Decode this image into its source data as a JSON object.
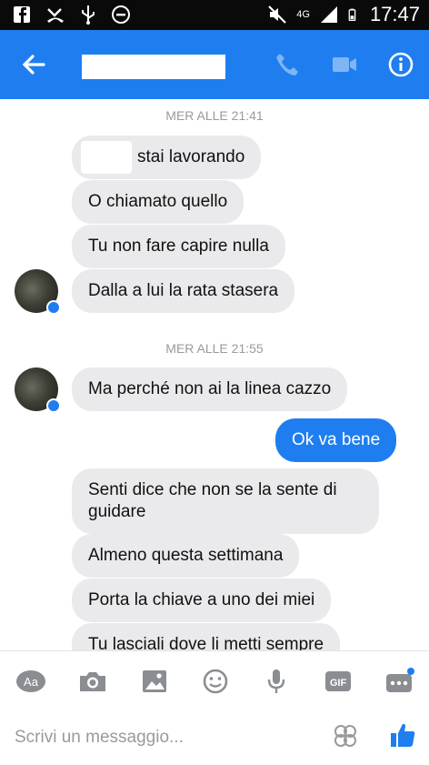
{
  "status_bar": {
    "time": "17:47",
    "network": "4G"
  },
  "header": {
    "contact_name": ""
  },
  "chat": {
    "separators": [
      "MER ALLE 21:41",
      "MER ALLE 21:55"
    ],
    "messages": [
      "stai lavorando",
      "O chiamato quello",
      "Tu non fare capire nulla",
      "Dalla a lui la rata stasera",
      "Ma perché non ai la linea cazzo",
      "Ok va bene",
      "Senti dice che non se la sente di guidare",
      "Almeno questa settimana",
      "Porta la chiave a uno dei miei",
      "Tu lasciali dove li metti sempre"
    ]
  },
  "composer": {
    "placeholder": "Scrivi un messaggio..."
  },
  "colors": {
    "accent": "#1e7ef0",
    "incoming_bubble": "#eaeaec",
    "status_bar": "#0a0a0a"
  },
  "icons": [
    "back-arrow-icon",
    "phone-icon",
    "video-icon",
    "info-icon",
    "text-size-icon",
    "camera-icon",
    "image-icon",
    "emoji-icon",
    "microphone-icon",
    "gif-icon",
    "more-icon",
    "like-icon"
  ]
}
